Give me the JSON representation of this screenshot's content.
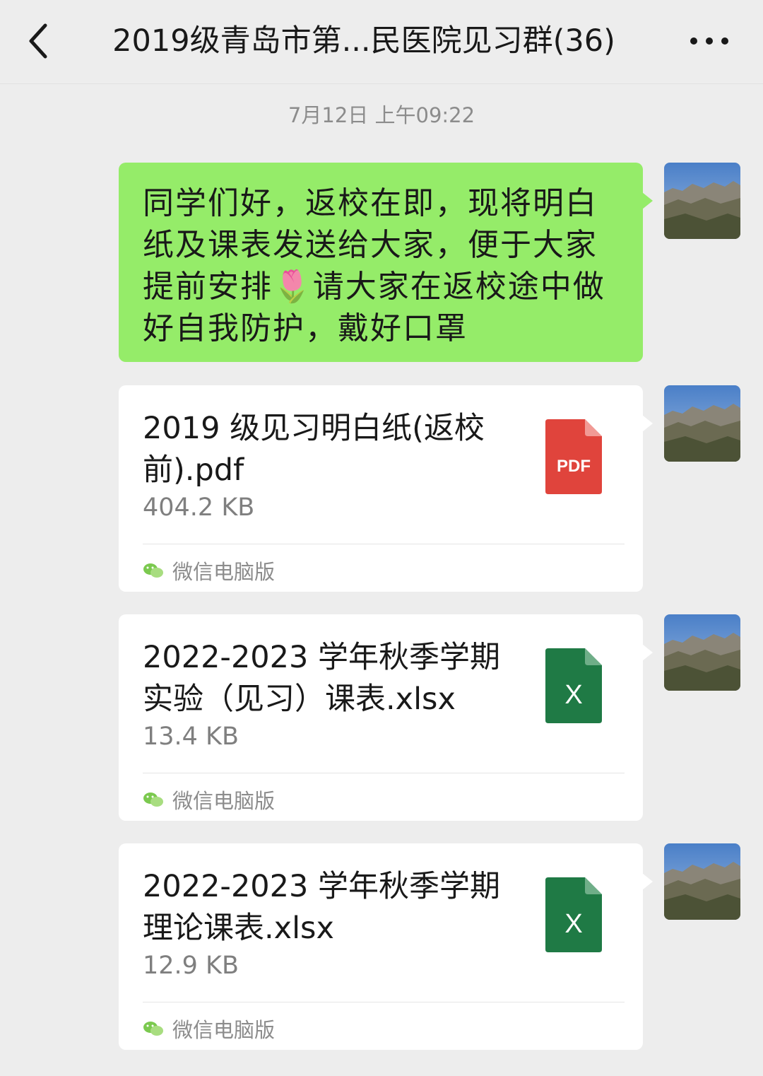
{
  "header": {
    "title": "2019级青岛市第...民医院见习群(36)"
  },
  "chat": {
    "timestamp": "7月12日 上午09:22",
    "message": {
      "text_1": "同学们好，返校在即，现将明白纸及课表发送给大家，便于大家提前安排",
      "emoji": "🌷",
      "text_2": "请大家在返校途中做好自我防护，戴好口罩"
    },
    "files": [
      {
        "name": "2019 级见习明白纸(返校前).pdf",
        "size": "404.2 KB",
        "type": "PDF",
        "source": "微信电脑版",
        "color": "#e0443c"
      },
      {
        "name": "2022-2023 学年秋季学期实验（见习）课表.xlsx",
        "size": "13.4 KB",
        "type": "X",
        "source": "微信电脑版",
        "color": "#1f7a45"
      },
      {
        "name": "2022-2023 学年秋季学期理论课表.xlsx",
        "size": "12.9 KB",
        "type": "X",
        "source": "微信电脑版",
        "color": "#1f7a45"
      }
    ]
  },
  "colors": {
    "background": "#ededed",
    "bubble_green": "#95ec69",
    "card": "#ffffff",
    "pdf_red": "#e0443c",
    "excel_green": "#1f7a45",
    "wechat_green": "#7bc94f"
  }
}
